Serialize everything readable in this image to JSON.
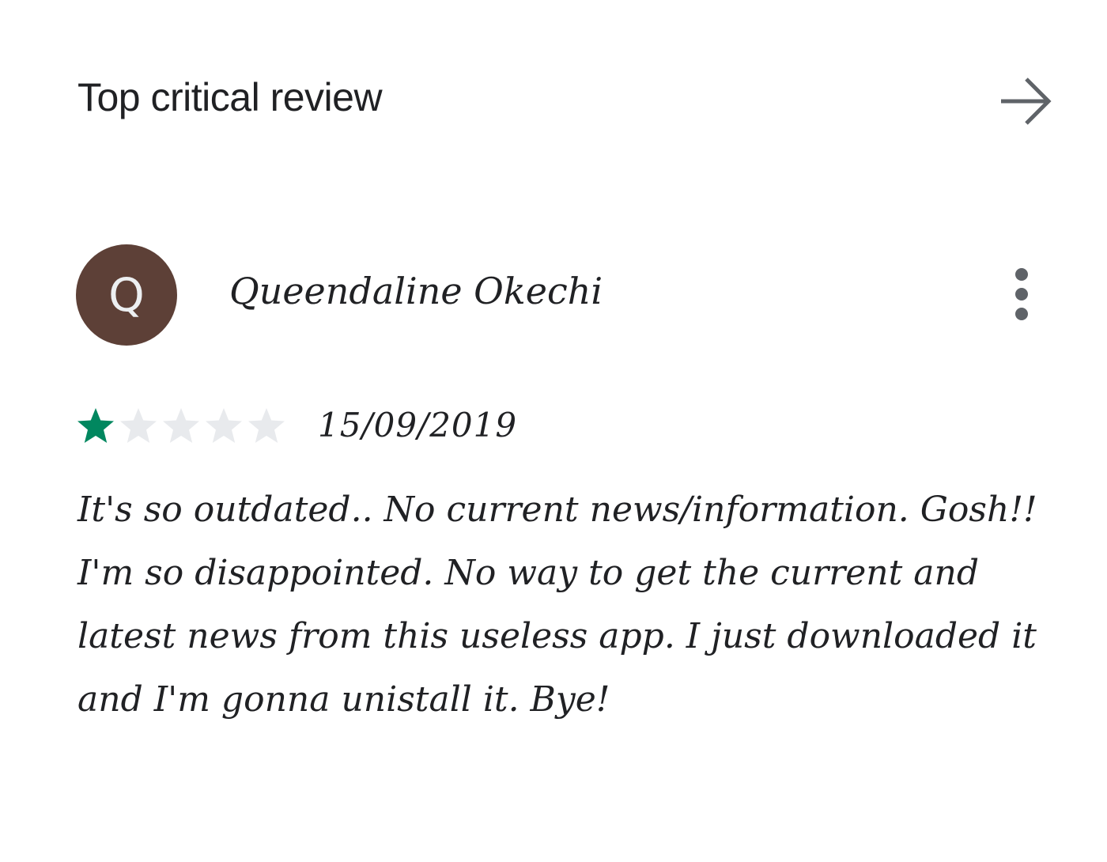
{
  "header": {
    "title": "Top critical review",
    "arrow_icon": "arrow-right-icon"
  },
  "review": {
    "avatar_letter": "Q",
    "avatar_color": "#5d4037",
    "reviewer_name": "Queendaline Okechi",
    "more_icon": "more-vert-icon",
    "rating": 1,
    "max_rating": 5,
    "star_filled_color": "#01875f",
    "star_empty_color": "#e8eaed",
    "date": "15/09/2019",
    "text": "It's so outdated.. No current news/information. Gosh!! I'm so disappointed. No way to get the current and latest news from this useless app. I just downloaded it and I'm gonna unistall it. Bye!"
  }
}
